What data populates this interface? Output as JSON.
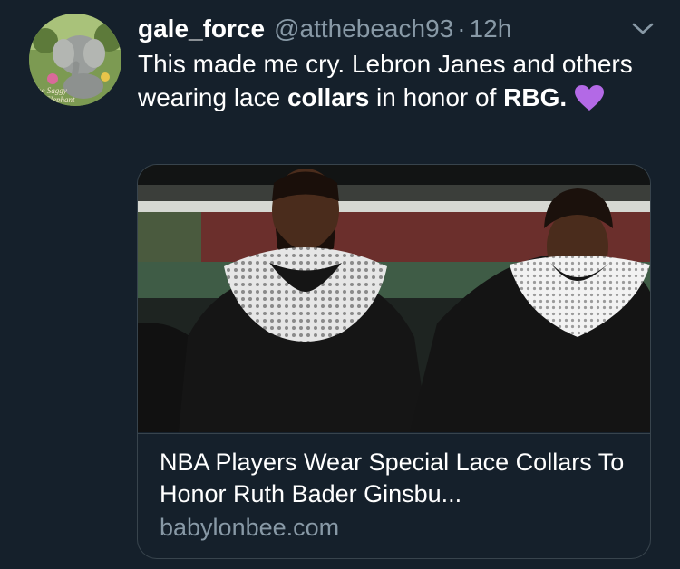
{
  "tweet": {
    "display_name": "gale_force",
    "handle": "@atthebeach93",
    "separator": "·",
    "timestamp": "12h",
    "text_part1": "This made me cry. Lebron Janes and others wearing lace ",
    "text_bold": "collars",
    "text_part2": " in honor of ",
    "text_bold2": "RBG.",
    "emoji_icon": "purple-heart-icon"
  },
  "avatar": {
    "caption_line1": "The Saggy",
    "caption_line2": "Elephant"
  },
  "card": {
    "title": "NBA Players Wear Special Lace Collars To Honor Ruth Bader Ginsbu...",
    "domain": "babylonbee.com"
  },
  "colors": {
    "background": "#15202b",
    "secondary_text": "#8899a6",
    "border": "#38444d",
    "heart": "#b369e6"
  }
}
